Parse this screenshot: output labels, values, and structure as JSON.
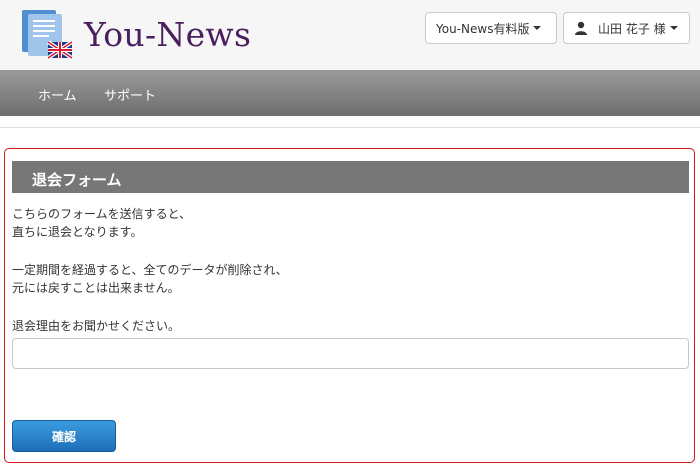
{
  "header": {
    "brand": "You-News",
    "plan_menu_label": "You-News有料版",
    "user_menu_label": "山田 花子 様"
  },
  "nav": {
    "items": [
      {
        "label": "ホーム"
      },
      {
        "label": "サポート"
      }
    ]
  },
  "form": {
    "title": "退会フォーム",
    "lines": [
      "こちらのフォームを送信すると、",
      "直ちに退会となります。",
      "一定期間を経過すると、全てのデータが削除され、",
      "元には戻すことは出来ません。",
      "退会理由をお聞かせください。"
    ],
    "reason_value": "",
    "confirm_label": "確認"
  },
  "icons": {
    "logo": "newspaper-flag-icon",
    "user": "user-icon",
    "dropdown": "caret-down-icon"
  },
  "colors": {
    "brand": "#4a1f5e",
    "panel_border": "#d11a1a",
    "button_primary": "#2a82c9"
  }
}
